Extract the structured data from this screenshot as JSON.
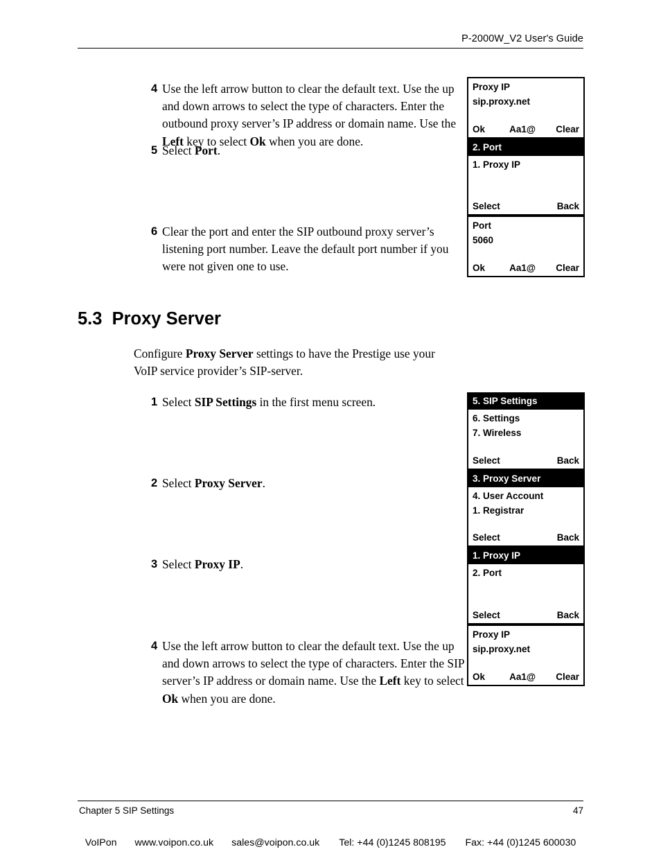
{
  "header": {
    "title": "P-2000W_V2 User's Guide"
  },
  "steps": {
    "top_4": {
      "num": "4",
      "text_parts": [
        {
          "t": "Use the left arrow button to clear the default text. Use the up and down arrows to select the type of characters. Enter the outbound proxy server’s IP address or domain name. Use the ",
          "b": false
        },
        {
          "t": "Left",
          "b": true
        },
        {
          "t": " key to select ",
          "b": false
        },
        {
          "t": "Ok",
          "b": true
        },
        {
          "t": " when you are done.",
          "b": false
        }
      ]
    },
    "top_5": {
      "num": "5",
      "text_parts": [
        {
          "t": "Select ",
          "b": false
        },
        {
          "t": "Port",
          "b": true
        },
        {
          "t": ".",
          "b": false
        }
      ]
    },
    "top_6": {
      "num": "6",
      "text_parts": [
        {
          "t": "Clear the port and enter the SIP outbound proxy server’s listening port number. Leave the default port number if you were not given one to use.",
          "b": false
        }
      ]
    },
    "bot_1": {
      "num": "1",
      "text_parts": [
        {
          "t": "Select ",
          "b": false
        },
        {
          "t": "SIP Settings",
          "b": true
        },
        {
          "t": " in the first menu screen.",
          "b": false
        }
      ]
    },
    "bot_2": {
      "num": "2",
      "text_parts": [
        {
          "t": "Select ",
          "b": false
        },
        {
          "t": "Proxy Server",
          "b": true
        },
        {
          "t": ".",
          "b": false
        }
      ]
    },
    "bot_3": {
      "num": "3",
      "text_parts": [
        {
          "t": "Select ",
          "b": false
        },
        {
          "t": "Proxy IP",
          "b": true
        },
        {
          "t": ".",
          "b": false
        }
      ]
    },
    "bot_4": {
      "num": "4",
      "text_parts": [
        {
          "t": "Use the left arrow button to clear the default text. Use the up and down arrows to select the type of characters. Enter the SIP server’s IP address or domain name. Use the ",
          "b": false
        },
        {
          "t": "Left",
          "b": true
        },
        {
          "t": " key to select ",
          "b": false
        },
        {
          "t": "Ok",
          "b": true
        },
        {
          "t": " when you are done.",
          "b": false
        }
      ]
    }
  },
  "section": {
    "number": "5.3",
    "title": "Proxy Server",
    "heading_display": "5.3  Proxy Server",
    "intro_parts": [
      {
        "t": "Configure ",
        "b": false
      },
      {
        "t": "Proxy Server",
        "b": true
      },
      {
        "t": " settings to have the Prestige use your VoIP service provider’s SIP-server.",
        "b": false
      }
    ]
  },
  "lcd_groups": [
    {
      "id": "group-top",
      "screens": [
        {
          "id": "proxy-ip-entry",
          "highlighted_title": null,
          "lines": [
            "Proxy IP",
            "sip.proxy.net"
          ],
          "softkeys": [
            "Ok",
            "Aa1@",
            "Clear"
          ]
        },
        {
          "id": "port-menu",
          "highlighted_title": "2. Port",
          "lines": [
            "1. Proxy IP"
          ],
          "softkeys": [
            "Select",
            "",
            "Back"
          ]
        },
        {
          "id": "port-entry",
          "highlighted_title": null,
          "lines": [
            "Port",
            "5060"
          ],
          "softkeys": [
            "Ok",
            "Aa1@",
            "Clear"
          ]
        }
      ]
    },
    {
      "id": "group-bottom",
      "screens": [
        {
          "id": "sip-settings-menu",
          "highlighted_title": "5. SIP Settings",
          "lines": [
            "6. Settings",
            "7. Wireless"
          ],
          "softkeys": [
            "Select",
            "",
            "Back"
          ]
        },
        {
          "id": "proxy-server-menu",
          "highlighted_title": "3. Proxy Server",
          "lines": [
            "4. User Account",
            "1. Registrar"
          ],
          "softkeys": [
            "Select",
            "",
            "Back"
          ]
        },
        {
          "id": "proxy-ip-menu",
          "highlighted_title": "1. Proxy IP",
          "lines": [
            "2. Port"
          ],
          "softkeys": [
            "Select",
            "",
            "Back"
          ]
        },
        {
          "id": "proxy-ip-entry-2",
          "highlighted_title": null,
          "lines": [
            "Proxy IP",
            "sip.proxy.net"
          ],
          "softkeys": [
            "Ok",
            "Aa1@",
            "Clear"
          ]
        }
      ]
    }
  ],
  "footer": {
    "chapter": "Chapter 5 SIP Settings",
    "page_number": "47",
    "brand": "VoIPon",
    "website": "www.voipon.co.uk",
    "email": "sales@voipon.co.uk",
    "tel": "Tel: +44 (0)1245 808195",
    "fax": "Fax: +44 (0)1245 600030"
  },
  "colors": {
    "page_background": "#ffffff",
    "text": "#000000",
    "lcd_highlight_background": "#000000",
    "lcd_highlight_text": "#ffffff",
    "lcd_background": "#ffffff"
  }
}
